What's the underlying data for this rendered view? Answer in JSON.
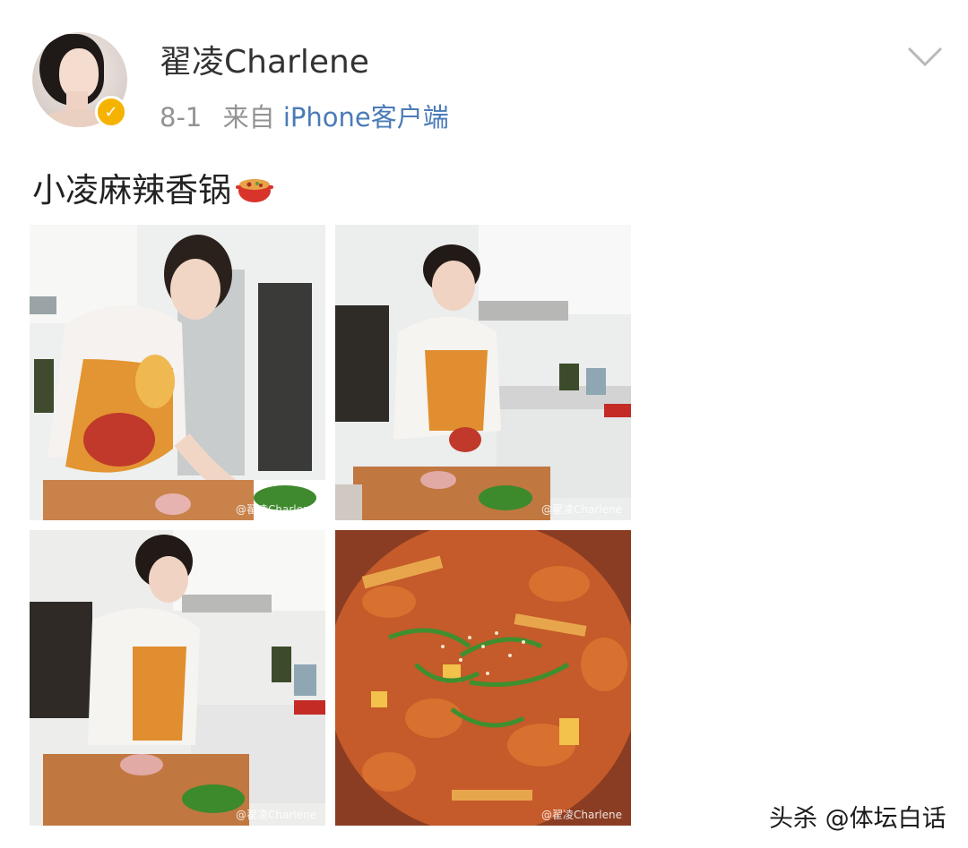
{
  "post": {
    "username": "翟凌Charlene",
    "date": "8-1",
    "source_prefix": "来自",
    "source": "iPhone客户端",
    "text": "小凌麻辣香锅",
    "emoji_icon": "hotpot-icon",
    "verified_icon": "verified-badge-icon",
    "menu_icon": "chevron-down-icon"
  },
  "photos": [
    {
      "watermark": "@翟凌Charlene"
    },
    {
      "watermark": "@翟凌Charlene"
    },
    {
      "watermark": "@翟凌Charlene"
    },
    {
      "watermark": "@翟凌Charlene"
    }
  ],
  "footer": {
    "text": "头杀 @体坛白话"
  },
  "colors": {
    "link": "#4a7bb7",
    "meta": "#939393",
    "verified": "#f5b300"
  }
}
